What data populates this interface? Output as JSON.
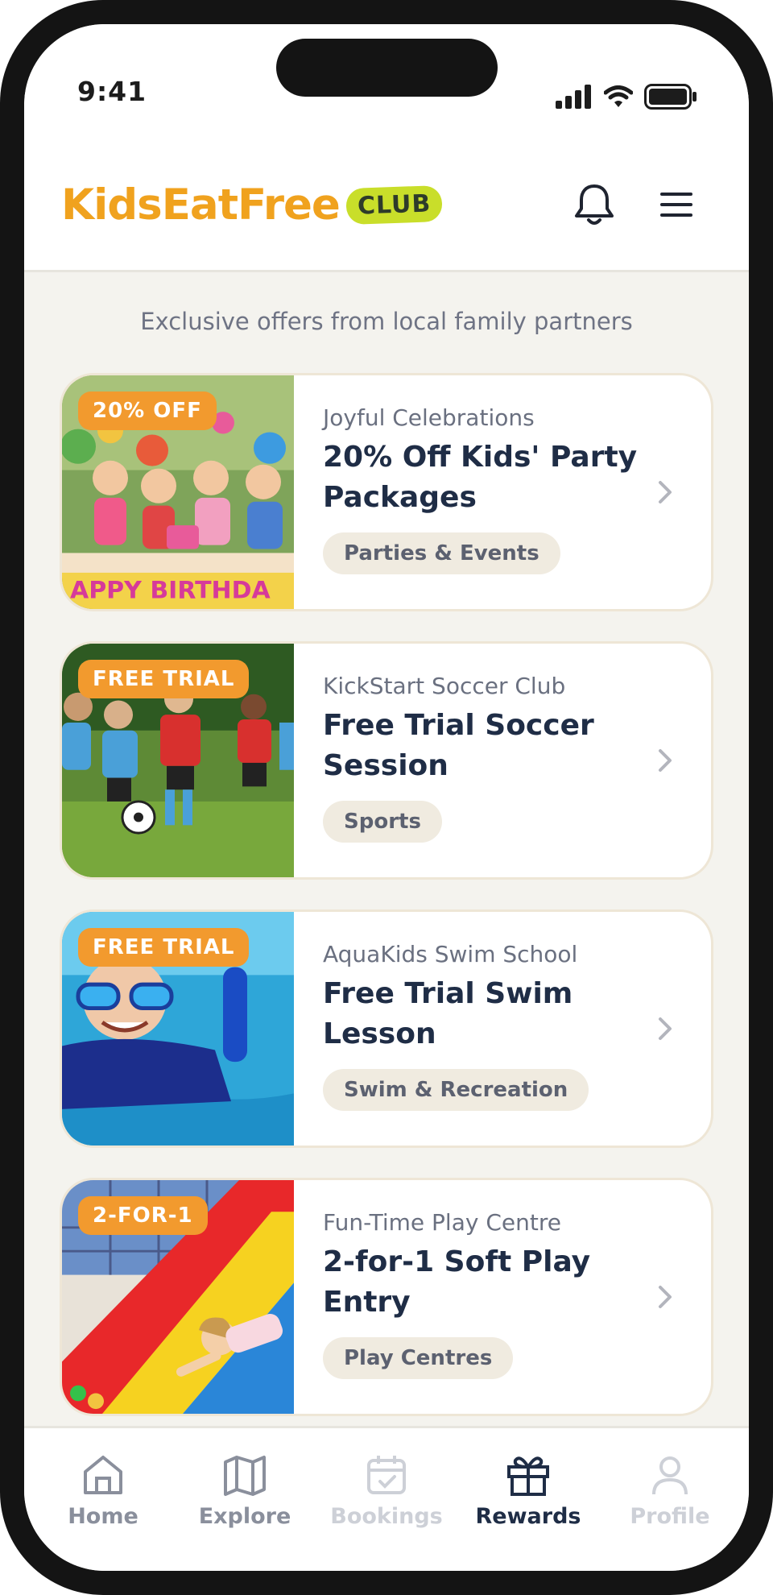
{
  "status": {
    "time": "9:41"
  },
  "header": {
    "brand_name": "KidsEatFree",
    "brand_badge": "CLUB",
    "brand_color": "#f0a21e",
    "badge_color": "#c9de2a"
  },
  "subtitle": "Exclusive offers from local family partners",
  "offers": [
    {
      "badge": "20% OFF",
      "partner": "Joyful Celebrations",
      "title": "20% Off Kids' Party Packages",
      "category": "Parties & Events",
      "image": "kids-birthday-party-photo"
    },
    {
      "badge": "FREE TRIAL",
      "partner": "KickStart Soccer Club",
      "title": "Free Trial Soccer Session",
      "category": "Sports",
      "image": "kids-playing-soccer-photo"
    },
    {
      "badge": "FREE TRIAL",
      "partner": "AquaKids Swim School",
      "title": "Free Trial Swim Lesson",
      "category": "Swim & Recreation",
      "image": "child-swimming-goggles-photo"
    },
    {
      "badge": "2-FOR-1",
      "partner": "Fun-Time Play Centre",
      "title": "2-for-1 Soft Play Entry",
      "category": "Play Centres",
      "image": "child-on-play-slide-photo"
    }
  ],
  "nav": {
    "items": [
      {
        "label": "Home",
        "icon": "home-icon",
        "color": "#8a8f9c"
      },
      {
        "label": "Explore",
        "icon": "map-icon",
        "color": "#8a8f9c"
      },
      {
        "label": "Bookings",
        "icon": "calendar-check-icon",
        "color": "#cdd0d7"
      },
      {
        "label": "Rewards",
        "icon": "gift-icon",
        "color": "#1f2d46",
        "active": true
      },
      {
        "label": "Profile",
        "icon": "user-icon",
        "color": "#cdd0d7"
      }
    ]
  },
  "colors": {
    "badge": "#f29a2e",
    "title": "#1f2d46",
    "chip": "#f0ebe0"
  }
}
